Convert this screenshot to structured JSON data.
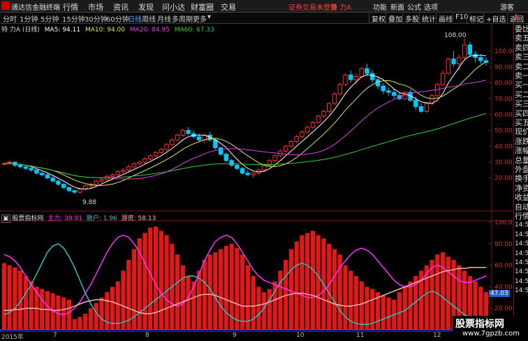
{
  "titlebar": {
    "app_name": "通达信金融终端",
    "menu": [
      "行情",
      "市场",
      "资讯",
      "发现",
      "问小达",
      "财富圈",
      "交易"
    ],
    "status": "证券交易未登录",
    "security": "特 力A",
    "right_menu": [
      "功能",
      "新面",
      "公式",
      "选项",
      "游客"
    ]
  },
  "timeframes": [
    "分时",
    "1分钟",
    "5分钟",
    "15分钟",
    "30分钟",
    "60分钟",
    "日线",
    "周线",
    "月线",
    "多周期",
    "更多"
  ],
  "active_timeframe": "日线",
  "toolbar_buttons": [
    "复权",
    "叠加",
    "多股",
    "统计",
    "画线",
    "F10",
    "标记",
    "+自选",
    "返回"
  ],
  "main_info": {
    "title": "特 力A (日线)",
    "ma5": "MA5: 94.11",
    "ma10": "MA10: 94.00",
    "ma20": "MA20: 84.95",
    "ma60": "MA60: 67.33"
  },
  "sub_info": {
    "title": "股票指标网",
    "main_force": "主力: 39.91",
    "retail": "散户: 1.96",
    "hot_money": "游资: 58.13"
  },
  "price_axis": [
    "100.00",
    "90.00",
    "80.00",
    "70.00",
    "60.00",
    "50.00",
    "40.00",
    "30.00",
    "20.00"
  ],
  "indicator_axis": [
    "100.0",
    "80.00",
    "60.00",
    "40.00",
    "20.00"
  ],
  "indicator_marker": "47.03",
  "high_label": "108.00",
  "low_label": "9.88",
  "x_labels": [
    "2015年",
    "7",
    "8",
    "9",
    "10",
    "11",
    "12"
  ],
  "right_panel": [
    "委比",
    "卖五",
    "卖四",
    "卖三",
    "卖二",
    "卖一",
    "买一",
    "买二",
    "买三",
    "买四",
    "买五",
    "现价",
    "涨跌",
    "涨幅",
    "总量",
    "外盘",
    "换手",
    "净资",
    "收益",
    "自动",
    "行情",
    "14:50",
    "14:50",
    "14:50",
    "14:50",
    "14:50",
    "14:50",
    "14:50",
    "14:50"
  ],
  "watermark": {
    "line1": "股票指标网",
    "line2": "www.7gpzb.com"
  },
  "colors": {
    "up": "#ff3030",
    "down": "#00c8ff",
    "ma5": "#ffffff",
    "ma10": "#e8e060",
    "ma20": "#e040e0",
    "ma60": "#30d040",
    "main_force": "#ff30ff",
    "retail": "#30c0c0",
    "hot_money": "#ffb0b0"
  },
  "chart_data": {
    "type": "candlestick",
    "title": "特 力A (日线)",
    "ylim": [
      0,
      112
    ],
    "candles": [
      [
        29,
        30,
        28,
        29
      ],
      [
        29,
        31,
        28,
        30
      ],
      [
        30,
        30,
        27,
        28
      ],
      [
        28,
        29,
        26,
        27
      ],
      [
        27,
        28,
        25,
        26
      ],
      [
        26,
        27,
        24,
        25
      ],
      [
        25,
        25,
        22,
        23
      ],
      [
        23,
        24,
        21,
        22
      ],
      [
        22,
        23,
        19,
        20
      ],
      [
        20,
        21,
        17,
        18
      ],
      [
        18,
        19,
        15,
        16
      ],
      [
        16,
        17,
        13,
        14
      ],
      [
        14,
        14,
        11,
        12
      ],
      [
        12,
        12,
        10,
        11
      ],
      [
        11,
        14,
        10,
        13
      ],
      [
        13,
        16,
        12,
        15
      ],
      [
        15,
        17,
        13,
        16
      ],
      [
        16,
        19,
        15,
        18
      ],
      [
        18,
        20,
        17,
        19
      ],
      [
        19,
        22,
        18,
        21
      ],
      [
        21,
        23,
        20,
        22
      ],
      [
        22,
        25,
        21,
        24
      ],
      [
        24,
        26,
        23,
        25
      ],
      [
        25,
        28,
        24,
        27
      ],
      [
        27,
        30,
        26,
        29
      ],
      [
        29,
        31,
        28,
        30
      ],
      [
        30,
        33,
        29,
        32
      ],
      [
        32,
        35,
        31,
        34
      ],
      [
        34,
        37,
        33,
        36
      ],
      [
        36,
        39,
        35,
        38
      ],
      [
        38,
        42,
        37,
        41
      ],
      [
        41,
        45,
        40,
        44
      ],
      [
        44,
        48,
        43,
        47
      ],
      [
        47,
        51,
        46,
        50
      ],
      [
        50,
        52,
        47,
        48
      ],
      [
        48,
        50,
        45,
        46
      ],
      [
        46,
        48,
        43,
        44
      ],
      [
        44,
        48,
        42,
        47
      ],
      [
        47,
        49,
        43,
        44
      ],
      [
        44,
        45,
        38,
        39
      ],
      [
        39,
        40,
        34,
        35
      ],
      [
        35,
        36,
        30,
        31
      ],
      [
        31,
        32,
        27,
        28
      ],
      [
        28,
        29,
        25,
        26
      ],
      [
        26,
        27,
        22,
        23
      ],
      [
        23,
        25,
        21,
        22
      ],
      [
        22,
        24,
        20,
        23
      ],
      [
        23,
        26,
        22,
        25
      ],
      [
        25,
        29,
        24,
        28
      ],
      [
        28,
        32,
        27,
        31
      ],
      [
        31,
        35,
        30,
        34
      ],
      [
        34,
        38,
        33,
        37
      ],
      [
        37,
        41,
        36,
        40
      ],
      [
        40,
        44,
        39,
        43
      ],
      [
        43,
        47,
        42,
        46
      ],
      [
        46,
        50,
        45,
        49
      ],
      [
        49,
        53,
        48,
        52
      ],
      [
        52,
        56,
        51,
        55
      ],
      [
        55,
        60,
        54,
        59
      ],
      [
        59,
        63,
        58,
        62
      ],
      [
        62,
        68,
        61,
        67
      ],
      [
        67,
        74,
        66,
        73
      ],
      [
        73,
        80,
        72,
        79
      ],
      [
        79,
        86,
        78,
        85
      ],
      [
        85,
        88,
        80,
        82
      ],
      [
        82,
        86,
        79,
        84
      ],
      [
        84,
        90,
        83,
        89
      ],
      [
        89,
        92,
        84,
        86
      ],
      [
        86,
        88,
        80,
        82
      ],
      [
        82,
        84,
        76,
        78
      ],
      [
        78,
        80,
        73,
        75
      ],
      [
        75,
        77,
        72,
        74
      ],
      [
        74,
        76,
        70,
        72
      ],
      [
        72,
        74,
        69,
        70
      ],
      [
        70,
        75,
        69,
        74
      ],
      [
        74,
        76,
        68,
        69
      ],
      [
        69,
        71,
        63,
        65
      ],
      [
        65,
        67,
        61,
        62
      ],
      [
        62,
        68,
        61,
        67
      ],
      [
        67,
        73,
        66,
        72
      ],
      [
        72,
        80,
        71,
        79
      ],
      [
        79,
        88,
        78,
        86
      ],
      [
        86,
        96,
        85,
        95
      ],
      [
        95,
        100,
        90,
        92
      ],
      [
        92,
        98,
        88,
        96
      ],
      [
        96,
        108,
        94,
        104
      ],
      [
        104,
        106,
        96,
        98
      ],
      [
        98,
        100,
        93,
        96
      ],
      [
        96,
        98,
        92,
        94
      ],
      [
        94,
        96,
        91,
        93
      ]
    ],
    "indicator": {
      "bars": [
        62,
        60,
        58,
        55,
        50,
        45,
        40,
        38,
        36,
        34,
        32,
        30,
        28,
        10,
        12,
        15,
        20,
        25,
        30,
        35,
        40,
        45,
        55,
        65,
        75,
        85,
        90,
        95,
        96,
        92,
        88,
        80,
        70,
        60,
        50,
        45,
        55,
        65,
        70,
        72,
        75,
        78,
        80,
        76,
        70,
        60,
        50,
        40,
        35,
        38,
        45,
        55,
        65,
        75,
        82,
        88,
        90,
        92,
        88,
        85,
        80,
        75,
        70,
        60,
        55,
        50,
        45,
        40,
        38,
        35,
        32,
        30,
        28,
        35,
        40,
        45,
        50,
        55,
        60,
        65,
        70,
        72,
        68,
        65,
        60,
        55,
        50,
        45,
        40,
        35
      ],
      "main_force": [
        70,
        68,
        64,
        58,
        50,
        42,
        35,
        28,
        22,
        18,
        15,
        14,
        16,
        20,
        26,
        34,
        42,
        52,
        62,
        72,
        80,
        86,
        88,
        86,
        80,
        72,
        62,
        52,
        42,
        34,
        28,
        24,
        22,
        24,
        30,
        40,
        52,
        64,
        74,
        82,
        86,
        88,
        86,
        80,
        72,
        64,
        56,
        50,
        46,
        44,
        42,
        40,
        38,
        36,
        34,
        32,
        30,
        30,
        32,
        36,
        42,
        50,
        58,
        64,
        70,
        74,
        76,
        74,
        70,
        64,
        58,
        52,
        46,
        42,
        40,
        40,
        42,
        46,
        52,
        58,
        60,
        58,
        54,
        50,
        46,
        44,
        44,
        46,
        48,
        50
      ],
      "retail": [
        14,
        16,
        20,
        26,
        34,
        42,
        52,
        62,
        72,
        78,
        80,
        76,
        68,
        58,
        46,
        34,
        24,
        16,
        10,
        7,
        6,
        6,
        7,
        9,
        12,
        16,
        20,
        24,
        28,
        32,
        36,
        40,
        44,
        48,
        50,
        50,
        48,
        44,
        38,
        30,
        22,
        16,
        12,
        9,
        8,
        8,
        10,
        14,
        20,
        28,
        36,
        44,
        50,
        56,
        60,
        62,
        60,
        56,
        50,
        42,
        34,
        26,
        18,
        12,
        8,
        6,
        5,
        5,
        6,
        8,
        10,
        12,
        14,
        16,
        18,
        22,
        26,
        30,
        34,
        36,
        34,
        30,
        26,
        22,
        18,
        14,
        12,
        10,
        9,
        8
      ],
      "hot_money": [
        18,
        18,
        19,
        19,
        20,
        20,
        20,
        19,
        19,
        18,
        18,
        19,
        20,
        22,
        24,
        26,
        27,
        28,
        28,
        27,
        26,
        24,
        22,
        20,
        18,
        16,
        15,
        15,
        16,
        18,
        20,
        22,
        24,
        26,
        28,
        30,
        32,
        33,
        33,
        32,
        30,
        28,
        26,
        24,
        22,
        22,
        22,
        23,
        24,
        26,
        28,
        30,
        32,
        33,
        34,
        34,
        33,
        32,
        30,
        28,
        26,
        24,
        23,
        22,
        22,
        23,
        24,
        26,
        28,
        30,
        32,
        34,
        36,
        38,
        40,
        42,
        44,
        46,
        48,
        50,
        52,
        54,
        55,
        56,
        57,
        57,
        58,
        58,
        58,
        58
      ]
    }
  }
}
